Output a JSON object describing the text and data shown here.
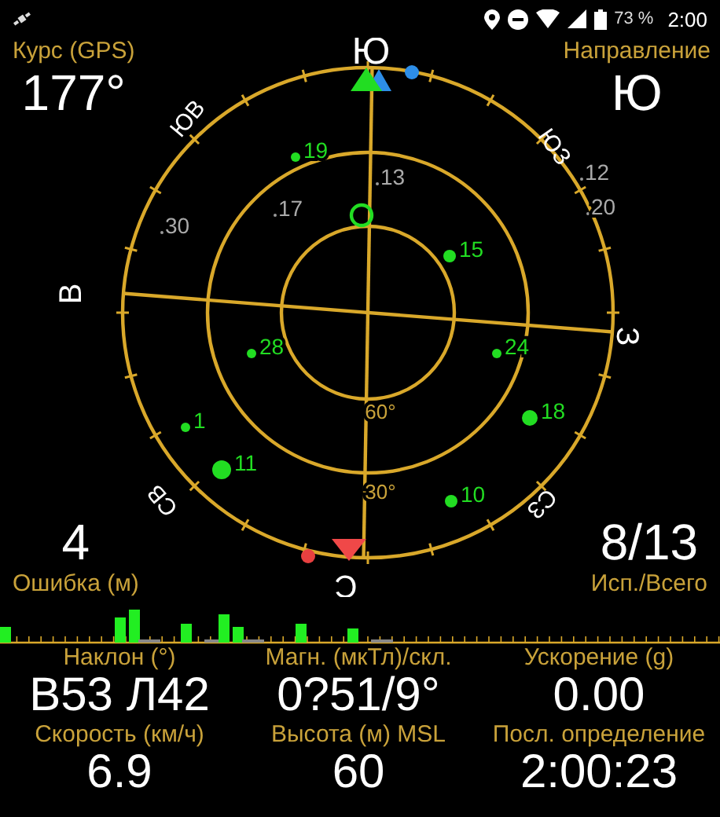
{
  "status_bar": {
    "battery": "73 %",
    "time": "2:00"
  },
  "course": {
    "label": "Курс (GPS)",
    "value": "177°"
  },
  "heading": {
    "label": "Направление",
    "value": "Ю"
  },
  "compass": {
    "directions": [
      {
        "kind": "s",
        "text": "Ю"
      },
      {
        "kind": "se",
        "text": "ЮВ"
      },
      {
        "kind": "sw",
        "text": "ЮЗ"
      },
      {
        "kind": "e",
        "text": "В"
      },
      {
        "kind": "w",
        "text": "З"
      },
      {
        "kind": "ne",
        "text": "СВ"
      },
      {
        "kind": "nw",
        "text": "СЗ"
      },
      {
        "kind": "n",
        "text": "С"
      }
    ],
    "elevations": [
      "60°",
      "30°"
    ],
    "satellites": [
      {
        "label": "19",
        "used": true
      },
      {
        "label": "13",
        "used": false
      },
      {
        "label": "17",
        "used": false
      },
      {
        "label": "30",
        "used": false
      },
      {
        "label": "12",
        "used": false
      },
      {
        "label": "20",
        "used": false
      },
      {
        "label": "15",
        "used": true
      },
      {
        "label": "28",
        "used": true
      },
      {
        "label": "24",
        "used": true
      },
      {
        "label": "1",
        "used": true
      },
      {
        "label": "18",
        "used": true
      },
      {
        "label": "11",
        "used": true
      },
      {
        "label": "10",
        "used": true
      }
    ]
  },
  "accuracy": {
    "label": "Ошибка (м)",
    "value": "4"
  },
  "satellite_count": {
    "label": "Исп./Всего",
    "value": "8/13"
  },
  "stats": [
    {
      "label": "Наклон (°)",
      "value": "В53 Л42"
    },
    {
      "label": "Магн. (мкТл)/скл.",
      "value": "0?51/9°"
    },
    {
      "label": "Ускорение (g)",
      "value": "0.00"
    },
    {
      "label": "Скорость (км/ч)",
      "value": "6.9"
    },
    {
      "label": "Высота (м) MSL",
      "value": "60"
    },
    {
      "label": "Посл. определение",
      "value": "2:00:23"
    }
  ]
}
